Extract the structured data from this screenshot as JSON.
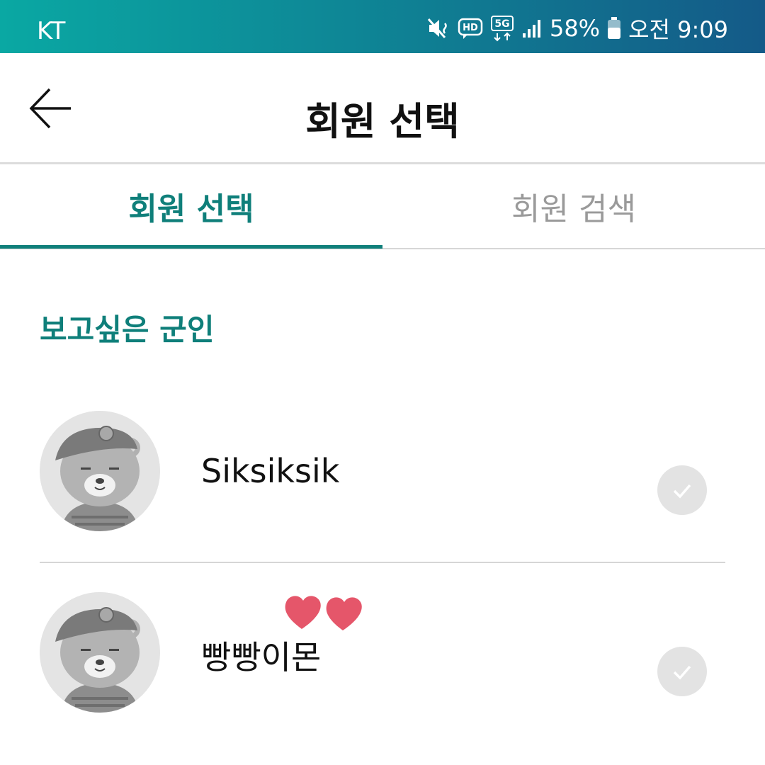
{
  "status_bar": {
    "carrier": "KT",
    "battery_percent": "58%",
    "time": "오전 9:09",
    "icons": [
      "mute-vibrate-icon",
      "hd-voice-icon",
      "5g-icon",
      "signal-icon",
      "battery-icon"
    ],
    "hd_label": "HD",
    "network_label": "5G"
  },
  "header": {
    "title": "회원 선택",
    "back_icon": "arrow-left-icon"
  },
  "tabs": [
    {
      "label": "회원 선택",
      "active": true
    },
    {
      "label": "회원 검색",
      "active": false
    }
  ],
  "section": {
    "title": "보고싶은 군인"
  },
  "members": [
    {
      "name": "Siksiksik",
      "avatar_icon": "soldier-bear-avatar",
      "checked": false
    },
    {
      "name": "빵빵이몬",
      "avatar_icon": "soldier-bear-avatar",
      "checked": false
    }
  ],
  "colors": {
    "accent": "#0f7f7a",
    "status_bar_start": "#0aa8a3",
    "status_bar_end": "#145a88",
    "check_bg": "#e3e3e3",
    "heart": "#e5566a"
  }
}
